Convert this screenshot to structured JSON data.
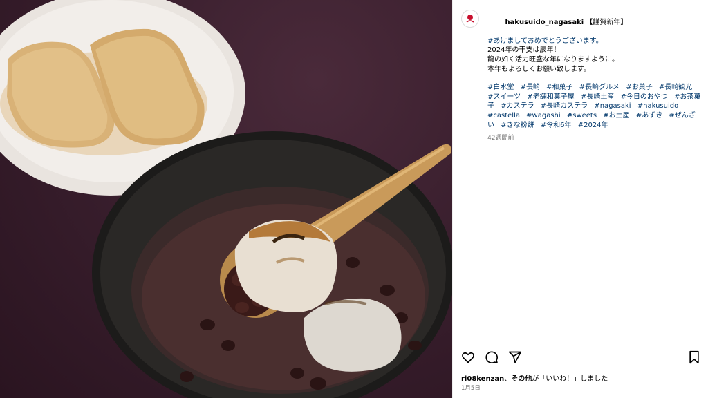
{
  "post": {
    "username": "hakusuido_nagasaki",
    "title_suffix": " 【謹賀新年】",
    "lines": [
      "#あけましておめでとうございます。",
      "2024年の干支は辰年！",
      "龍の如く活力旺盛な年になりますように。",
      "本年もよろしくお願い致します。"
    ],
    "hashtags": [
      "#白水堂",
      "#長崎",
      "#和菓子",
      "#長崎グルメ",
      "#お菓子",
      "#長崎観光",
      "#スイーツ",
      "#老舗和菓子屋",
      "#長崎土産",
      "#今日のおやつ",
      "#お茶菓子",
      "#カステラ",
      "#長崎カステラ",
      "#nagasaki",
      "#hakusuido",
      "#castella",
      "#wagashi",
      "#sweets",
      "#お土産",
      "#あずき",
      "#ぜんざい",
      "#きな粉餅",
      "#令和6年",
      "#2024年"
    ],
    "time_ago": "42週間前"
  },
  "footer": {
    "likes_user": "ri08kenzan",
    "likes_mid": "、",
    "likes_others": "その他",
    "likes_suffix": "が「いいね！」しました",
    "date": "1月5日"
  },
  "icons": {
    "like": "heart-icon",
    "comment": "comment-icon",
    "share": "share-icon",
    "save": "bookmark-icon"
  },
  "colors": {
    "hashtag": "#00376b",
    "muted": "#737373",
    "photo_bg": "#3a1f2e"
  }
}
